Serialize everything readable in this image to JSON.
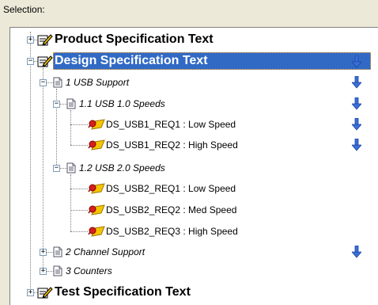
{
  "header": {
    "label": "Selection:"
  },
  "tree": {
    "product": {
      "label": "Product Specification   Text",
      "expander": "+"
    },
    "design": {
      "label": "Design Specification   Text",
      "expander": "−"
    },
    "usb_support": {
      "label": "1 USB Support",
      "expander": "−"
    },
    "usb1": {
      "label": "1.1 USB 1.0 Speeds",
      "expander": "−"
    },
    "usb1_req1": {
      "label": "DS_USB1_REQ1 : Low Speed"
    },
    "usb1_req2": {
      "label": "DS_USB1_REQ2 : High Speed"
    },
    "usb2": {
      "label": "1.2 USB 2.0 Speeds",
      "expander": "−"
    },
    "usb2_req1": {
      "label": "DS_USB2_REQ1 : Low Speed"
    },
    "usb2_req2": {
      "label": "DS_USB2_REQ2 : Med Speed"
    },
    "usb2_req3": {
      "label": "DS_USB2_REQ3 : High Speed"
    },
    "channel": {
      "label": "2 Channel Support",
      "expander": "+"
    },
    "counters": {
      "label": "3 Counters",
      "expander": "+"
    },
    "test": {
      "label": "Test Specification   Text",
      "expander": "+"
    }
  },
  "icons": {
    "spec": "spec-pencil-icon",
    "doc": "document-icon",
    "req": "requirement-icon",
    "arrow": "down-arrow-icon"
  },
  "colors": {
    "selection": "#316ac5",
    "arrow": "#3a6fd8",
    "panel": "#ffffff",
    "chrome": "#ece9d8"
  }
}
